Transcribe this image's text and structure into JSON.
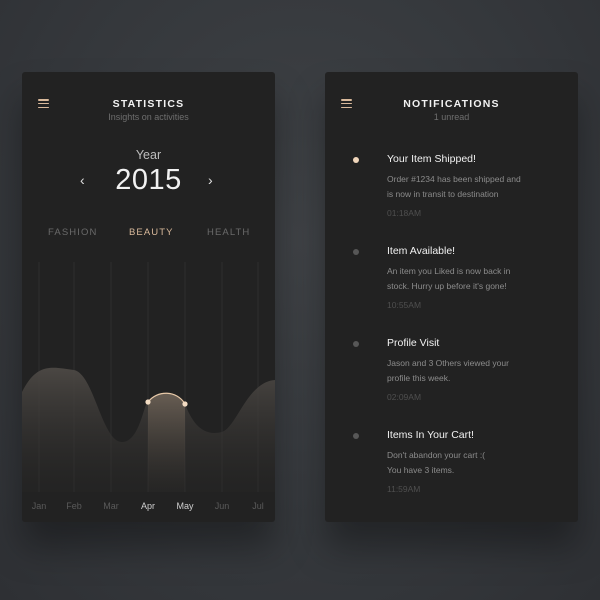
{
  "statistics": {
    "title": "STATISTICS",
    "subtitle": "Insights on activities",
    "year_label": "Year",
    "year": "2015",
    "prev_icon": "chevron-left-icon",
    "next_icon": "chevron-right-icon",
    "tabs": [
      {
        "label": "FASHION",
        "active": false
      },
      {
        "label": "BEAUTY",
        "active": true
      },
      {
        "label": "HEALTH",
        "active": false
      }
    ],
    "months": [
      "Jan",
      "Feb",
      "Mar",
      "Apr",
      "May",
      "Jun",
      "Jul"
    ],
    "active_months": [
      "Apr",
      "May"
    ],
    "accent_color": "#d9b99b"
  },
  "notifications": {
    "title": "NOTIFICATIONS",
    "subtitle": "1 unread",
    "items": [
      {
        "title": "Your Item Shipped!",
        "body_lines": [
          "Order #1234 has been shipped and",
          "is now in transit to destination"
        ],
        "time": "01:18AM",
        "unread": true
      },
      {
        "title": "Item Available!",
        "body_lines": [
          "An item you Liked is now back in",
          "stock. Hurry up before it's gone!"
        ],
        "time": "10:55AM",
        "unread": false
      },
      {
        "title": "Profile Visit",
        "body_lines": [
          "Jason and 3 Others viewed your",
          "profile this week."
        ],
        "time": "02:09AM",
        "unread": false
      },
      {
        "title": "Items In Your Cart!",
        "body_lines": [
          "Don't abandon your cart :(",
          "You have 3 items."
        ],
        "time": "11:59AM",
        "unread": false
      }
    ]
  }
}
